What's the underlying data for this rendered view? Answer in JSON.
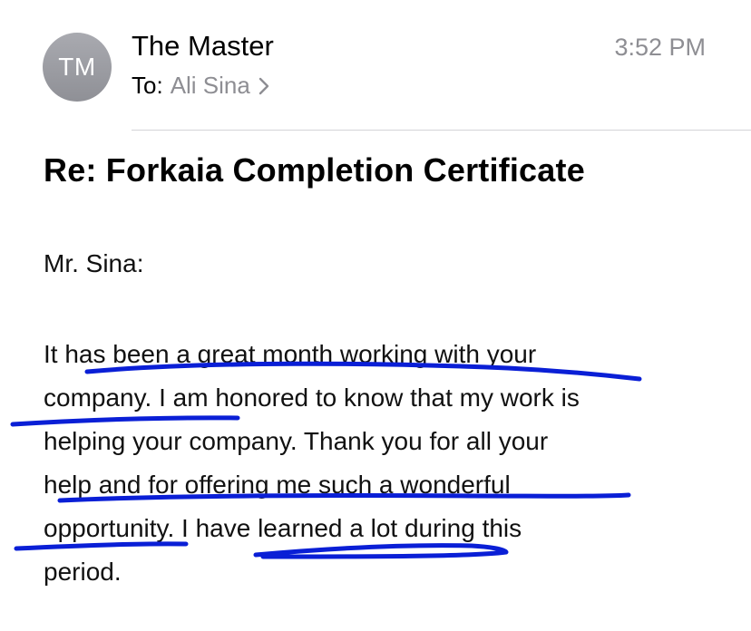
{
  "header": {
    "avatar_initials": "TM",
    "sender": "The Master",
    "to_label": "To:",
    "to_name": "Ali Sina",
    "time": "3:52 PM"
  },
  "message": {
    "subject": "Re: Forkaia Completion Certificate",
    "greeting": "Mr. Sina:",
    "body_lines": [
      "It has been a great month working with your",
      "company. I am honored to know that my work is",
      "helping your company. Thank you for all your",
      "help and for offering me such a wonderful",
      "opportunity. I have learned a lot during this",
      "period."
    ]
  },
  "annotations": {
    "color": "#0a1fd6",
    "style": "hand-drawn underlines"
  },
  "colors": {
    "avatar_bg": "#9c9da3",
    "secondary_text": "#8e8e93"
  }
}
